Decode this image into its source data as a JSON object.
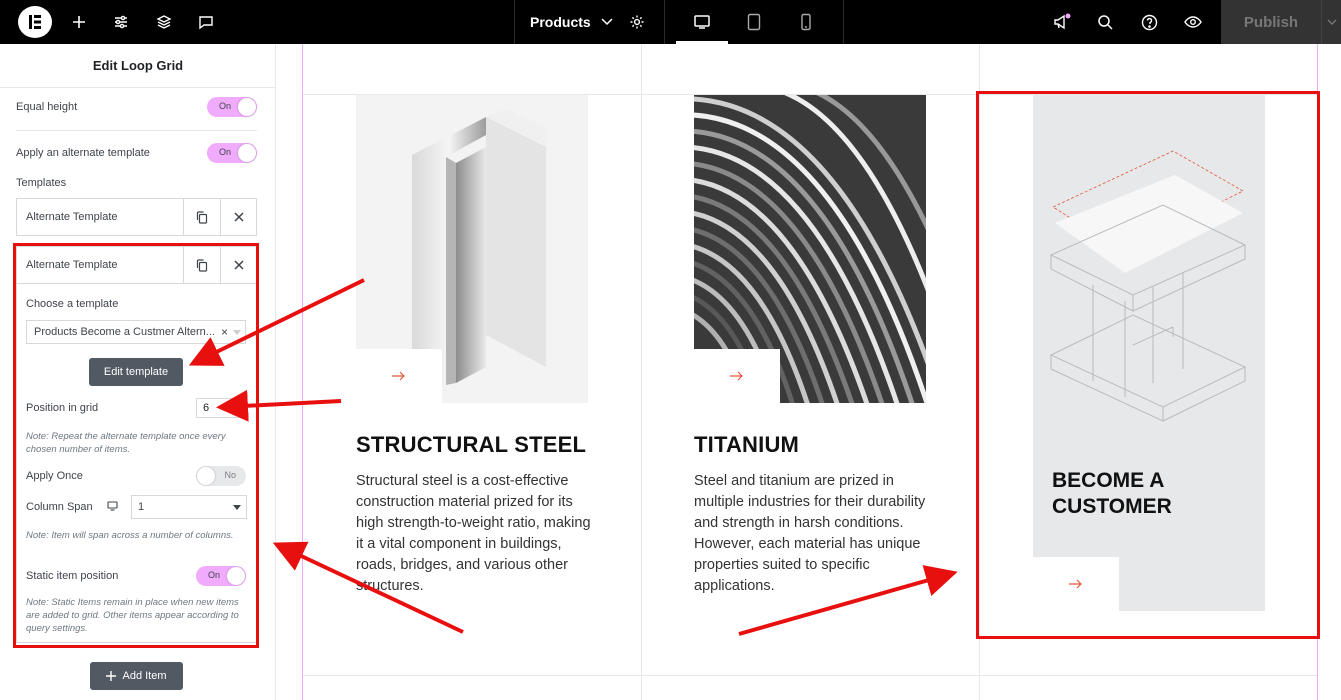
{
  "topbar": {
    "document_name": "Products",
    "publish_label": "Publish"
  },
  "panel": {
    "title": "Edit Loop Grid",
    "equal_height": {
      "label": "Equal height",
      "toggle": "On"
    },
    "alternate": {
      "label": "Apply an alternate template",
      "toggle": "On"
    },
    "templates_label": "Templates",
    "items": [
      {
        "title": "Alternate Template"
      },
      {
        "title": "Alternate Template"
      }
    ],
    "choose_label": "Choose a template",
    "choose_value": "Products Become a Custmer Altern...",
    "clear_glyph": "×",
    "edit_template_label": "Edit template",
    "position_label": "Position in grid",
    "position_value": "6",
    "position_note": "Note: Repeat the alternate template once every chosen number of items.",
    "apply_once_label": "Apply Once",
    "apply_once_toggle": "No",
    "column_span_label": "Column Span",
    "column_span_value": "1",
    "column_span_note": "Note: Item will span across a number of columns.",
    "static_label": "Static item position",
    "static_toggle": "On",
    "static_note": "Note: Static Items remain in place when new items are added to grid. Other items appear according to query settings.",
    "add_item_label": "Add Item"
  },
  "cards": [
    {
      "title": "STRUCTURAL STEEL",
      "text": "Structural steel is a cost-effective construction material prized for its high strength-to-weight ratio, making it a vital component in buildings, roads, bridges, and various other structures."
    },
    {
      "title": "TITANIUM",
      "text": "Steel and titanium are prized in multiple industries for their durability and strength in harsh conditions. However, each material has unique properties suited to specific applications."
    },
    {
      "title": "BECOME A CUSTOMER"
    }
  ],
  "colors": {
    "accent_pink": "#f0abfc",
    "annotation_red": "#e8100f",
    "arrow_orange": "#e2583e",
    "button_gray": "#515962"
  }
}
